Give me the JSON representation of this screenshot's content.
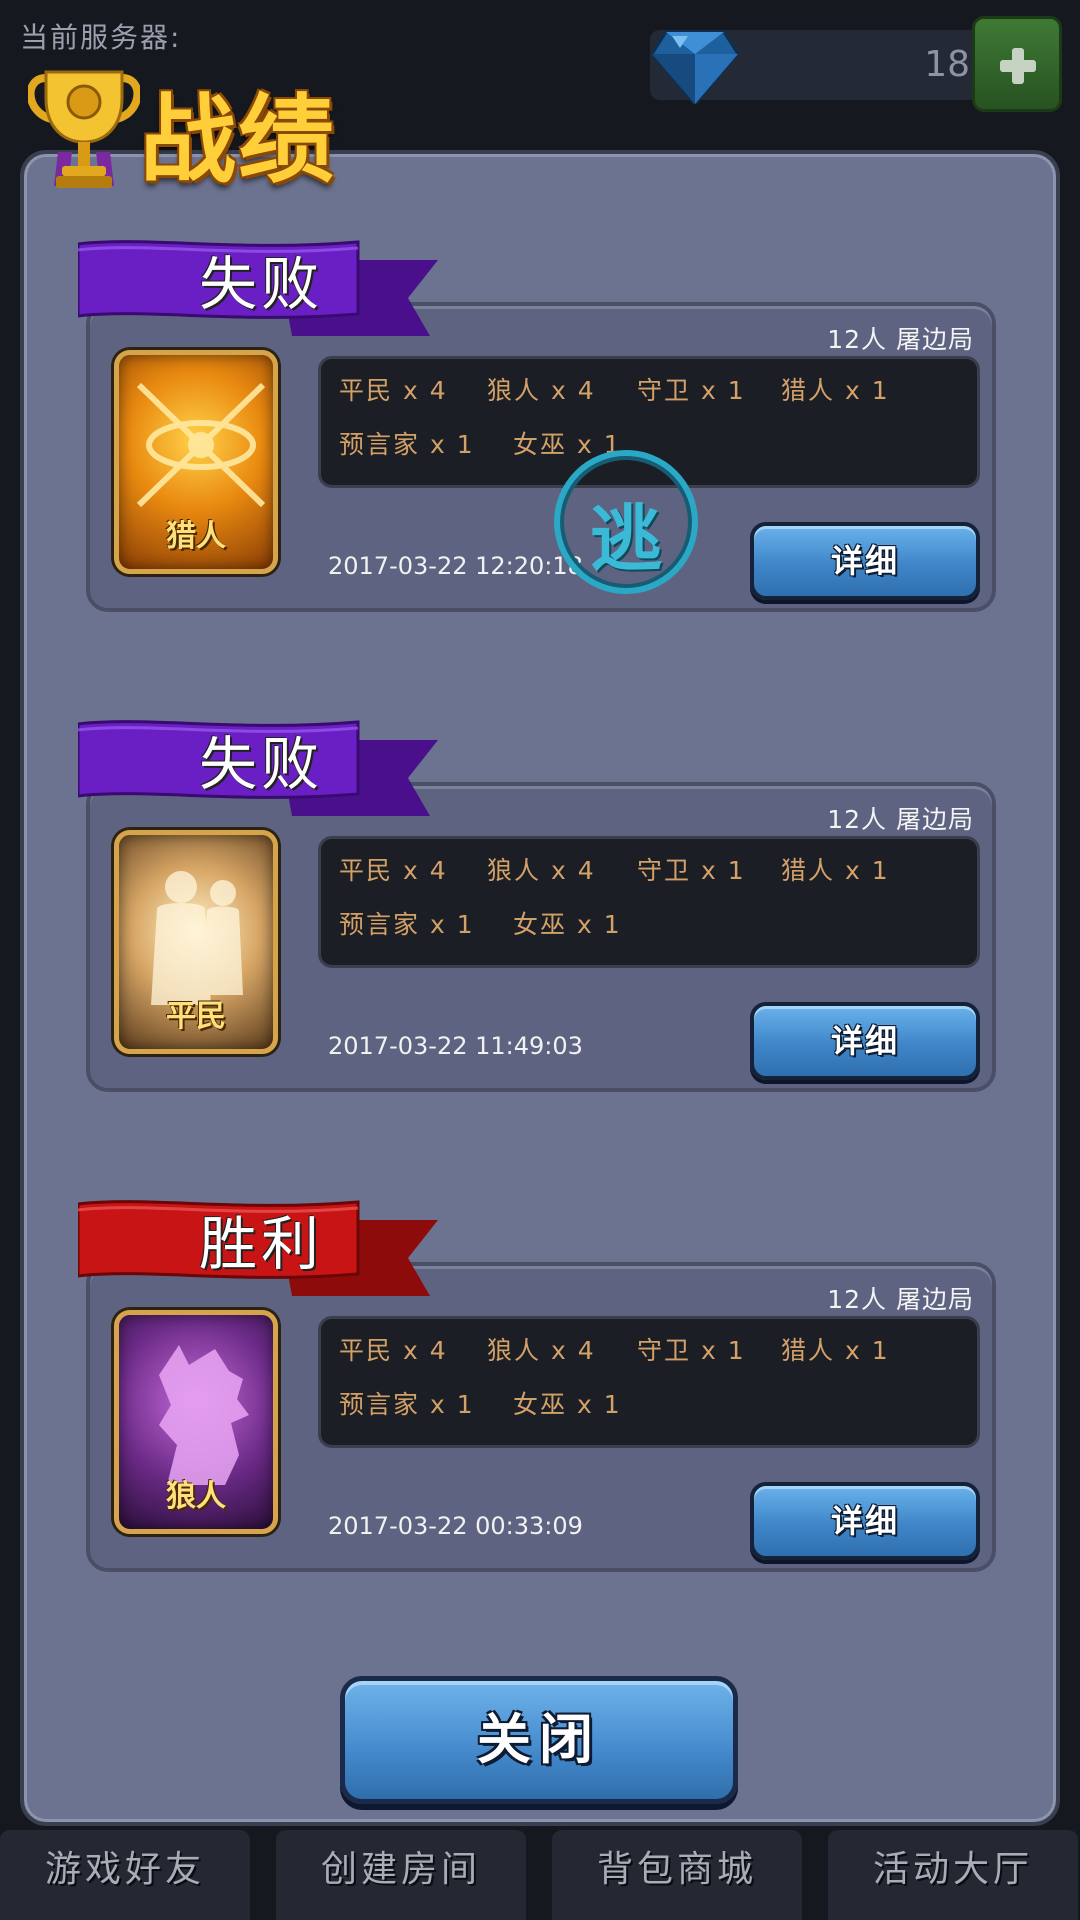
{
  "header": {
    "server_label": "当前服务器:",
    "gem_count": "18",
    "title": "战绩"
  },
  "records": [
    {
      "result": "失败",
      "result_color": "#6a1fc4",
      "players": "12人  屠边局",
      "role": "猎人",
      "role_theme": "hunter",
      "roles": [
        {
          "text": "平民 x 4"
        },
        {
          "text": "狼人 x 4"
        },
        {
          "text": "守卫 x 1"
        },
        {
          "text": "猎人 x 1"
        },
        {
          "text": "预言家 x 1"
        },
        {
          "text": "女巫 x 1"
        }
      ],
      "date": "2017-03-22 12:20:18",
      "detail_label": "详细",
      "stamp": "逃"
    },
    {
      "result": "失败",
      "result_color": "#6a1fc4",
      "players": "12人  屠边局",
      "role": "平民",
      "role_theme": "villager",
      "roles": [
        {
          "text": "平民 x 4"
        },
        {
          "text": "狼人 x 4"
        },
        {
          "text": "守卫 x 1"
        },
        {
          "text": "猎人 x 1"
        },
        {
          "text": "预言家 x 1"
        },
        {
          "text": "女巫 x 1"
        }
      ],
      "date": "2017-03-22 11:49:03",
      "detail_label": "详细"
    },
    {
      "result": "胜利",
      "result_color": "#c81414",
      "players": "12人  屠边局",
      "role": "狼人",
      "role_theme": "werewolf",
      "roles": [
        {
          "text": "平民 x 4"
        },
        {
          "text": "狼人 x 4"
        },
        {
          "text": "守卫 x 1"
        },
        {
          "text": "猎人 x 1"
        },
        {
          "text": "预言家 x 1"
        },
        {
          "text": "女巫 x 1"
        }
      ],
      "date": "2017-03-22 00:33:09",
      "detail_label": "详细"
    }
  ],
  "close_label": "关闭",
  "bottom_nav": [
    {
      "label": "游戏好友"
    },
    {
      "label": "创建房间"
    },
    {
      "label": "背包商城"
    },
    {
      "label": "活动大厅"
    }
  ]
}
